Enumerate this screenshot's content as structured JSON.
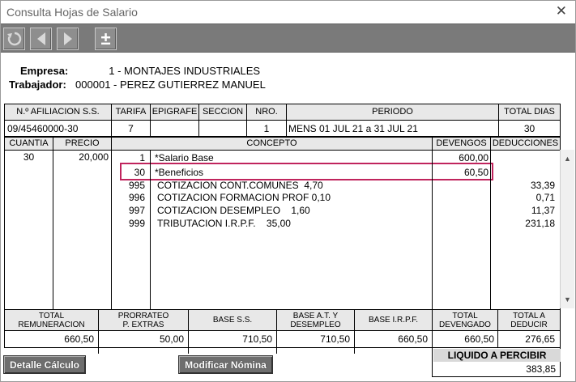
{
  "window": {
    "title": "Consulta Hojas de Salario",
    "close_glyph": "✕"
  },
  "toolbar": {
    "buttons": [
      {
        "name": "refresh-button",
        "icon": "refresh-icon"
      },
      {
        "name": "previous-button",
        "icon": "arrow-left-icon"
      },
      {
        "name": "next-button",
        "icon": "arrow-right-icon"
      },
      {
        "name": "plus-minus-button",
        "icon": "plus-minus-icon",
        "glyph": "±"
      }
    ]
  },
  "info": {
    "empresa_label": "Empresa:",
    "empresa_value": "1 - MONTAJES INDUSTRIALES",
    "trabajador_label": "Trabajador:",
    "trabajador_value": "000001 - PEREZ GUTIERREZ MANUEL"
  },
  "header_table": {
    "columns": [
      "N.º AFILIACION S.S.",
      "TARIFA",
      "EPIGRAFE",
      "SECCION",
      "NRO.",
      "PERIODO",
      "TOTAL DIAS"
    ],
    "values": [
      "09/45460000-30",
      "7",
      "",
      "",
      "1",
      "MENS 01 JUL 21 a 31 JUL 21",
      "30"
    ]
  },
  "concept_table": {
    "columns": {
      "cuantia": "CUANTIA",
      "precio": "PRECIO",
      "concepto": "CONCEPTO",
      "devengos": "DEVENGOS",
      "deducciones": "DEDUCCIONES"
    },
    "cuantia": "30",
    "precio": "20,000",
    "rows": [
      {
        "code": "1",
        "concept": "*Salario Base",
        "devengo": "600,00",
        "deduccion": ""
      },
      {
        "code": "30",
        "concept": "*Beneficios",
        "devengo": "60,50",
        "deduccion": ""
      },
      {
        "code": "995",
        "concept": "COTIZACION CONT.COMUNES  4,70",
        "devengo": "",
        "deduccion": "33,39"
      },
      {
        "code": "996",
        "concept": "COTIZACION FORMACION PROF 0,10",
        "devengo": "",
        "deduccion": "0,71"
      },
      {
        "code": "997",
        "concept": "COTIZACION DESEMPLEO    1,60",
        "devengo": "",
        "deduccion": "11,37"
      },
      {
        "code": "999",
        "concept": "TRIBUTACION I.R.P.F.    35,00",
        "devengo": "",
        "deduccion": "231,18"
      }
    ]
  },
  "totals": {
    "total_remuneracion_label": "TOTAL\nREMUNERACION",
    "prorrateo_label": "PRORRATEO\nP. EXTRAS",
    "base_ss_label": "BASE S.S.",
    "base_at_label": "BASE A.T. Y\nDESEMPLEO",
    "base_irpf_label": "BASE I.R.P.F.",
    "total_devengado_label": "TOTAL\nDEVENGADO",
    "total_deducir_label": "TOTAL A\nDEDUCIR",
    "total_remuneracion": "660,50",
    "prorrateo": "50,00",
    "base_ss": "710,50",
    "base_at": "710,50",
    "base_irpf": "660,50",
    "total_devengado": "660,50",
    "total_deducir": "276,65"
  },
  "liquido": {
    "label": "LIQUIDO A PERCIBIR",
    "value": "383,85"
  },
  "buttons": {
    "detalle": "Detalle Cálculo",
    "modificar": "Modificar Nómina"
  },
  "colors": {
    "toolbar": "#7a7a7a",
    "highlight": "#c0245d",
    "header_bg": "#e8e8e8"
  }
}
